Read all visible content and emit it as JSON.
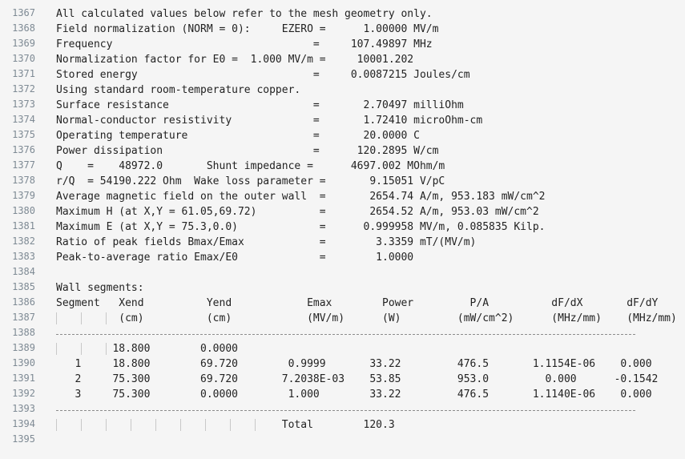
{
  "editor": {
    "lines": [
      {
        "n": "1367",
        "t": "All calculated values below refer to the mesh geometry only."
      },
      {
        "n": "1368",
        "t": "Field normalization (NORM = 0):     EZERO =      1.00000 MV/m"
      },
      {
        "n": "1369",
        "t": "Frequency                                =     107.49897 MHz"
      },
      {
        "n": "1370",
        "t": "Normalization factor for E0 =  1.000 MV/m =     10001.202"
      },
      {
        "n": "1371",
        "t": "Stored energy                            =     0.0087215 Joules/cm"
      },
      {
        "n": "1372",
        "t": "Using standard room-temperature copper."
      },
      {
        "n": "1373",
        "t": "Surface resistance                       =       2.70497 milliOhm"
      },
      {
        "n": "1374",
        "t": "Normal-conductor resistivity             =       1.72410 microOhm-cm"
      },
      {
        "n": "1375",
        "t": "Operating temperature                    =       20.0000 C"
      },
      {
        "n": "1376",
        "t": "Power dissipation                        =      120.2895 W/cm"
      },
      {
        "n": "1377",
        "t": "Q    =    48972.0       Shunt impedance =      4697.002 MOhm/m"
      },
      {
        "n": "1378",
        "t": "r/Q  = 54190.222 Ohm  Wake loss parameter =       9.15051 V/pC"
      },
      {
        "n": "1379",
        "t": "Average magnetic field on the outer wall  =       2654.74 A/m, 953.183 mW/cm^2"
      },
      {
        "n": "1380",
        "t": "Maximum H (at X,Y = 61.05,69.72)          =       2654.52 A/m, 953.03 mW/cm^2"
      },
      {
        "n": "1381",
        "t": "Maximum E (at X,Y = 75.3,0.0)             =      0.999958 MV/m, 0.085835 Kilp."
      },
      {
        "n": "1382",
        "t": "Ratio of peak fields Bmax/Emax            =        3.3359 mT/(MV/m)"
      },
      {
        "n": "1383",
        "t": "Peak-to-average ratio Emax/E0             =        1.0000"
      },
      {
        "n": "1384",
        "t": ""
      },
      {
        "n": "1385",
        "t": "Wall segments:"
      },
      {
        "n": "1386",
        "t": "Segment   Xend          Yend            Emax        Power         P/A          dF/dX       dF/dY"
      },
      {
        "n": "1387",
        "t": "          (cm)          (cm)            (MV/m)      (W)         (mW/cm^2)      (MHz/mm)    (MHz/mm)"
      },
      {
        "n": "1388",
        "t": ""
      },
      {
        "n": "1389",
        "t": "         18.800        0.0000"
      },
      {
        "n": "1390",
        "t": "   1     18.800        69.720        0.9999       33.22         476.5       1.1154E-06    0.000"
      },
      {
        "n": "1391",
        "t": "   2     75.300        69.720       7.2038E-03    53.85         953.0         0.000      -0.1542"
      },
      {
        "n": "1392",
        "t": "   3     75.300        0.0000        1.000        33.22         476.5       1.1140E-06    0.000"
      },
      {
        "n": "1393",
        "t": ""
      },
      {
        "n": "1394",
        "t": "                                    Total        120.3"
      },
      {
        "n": "1395",
        "t": ""
      }
    ]
  }
}
